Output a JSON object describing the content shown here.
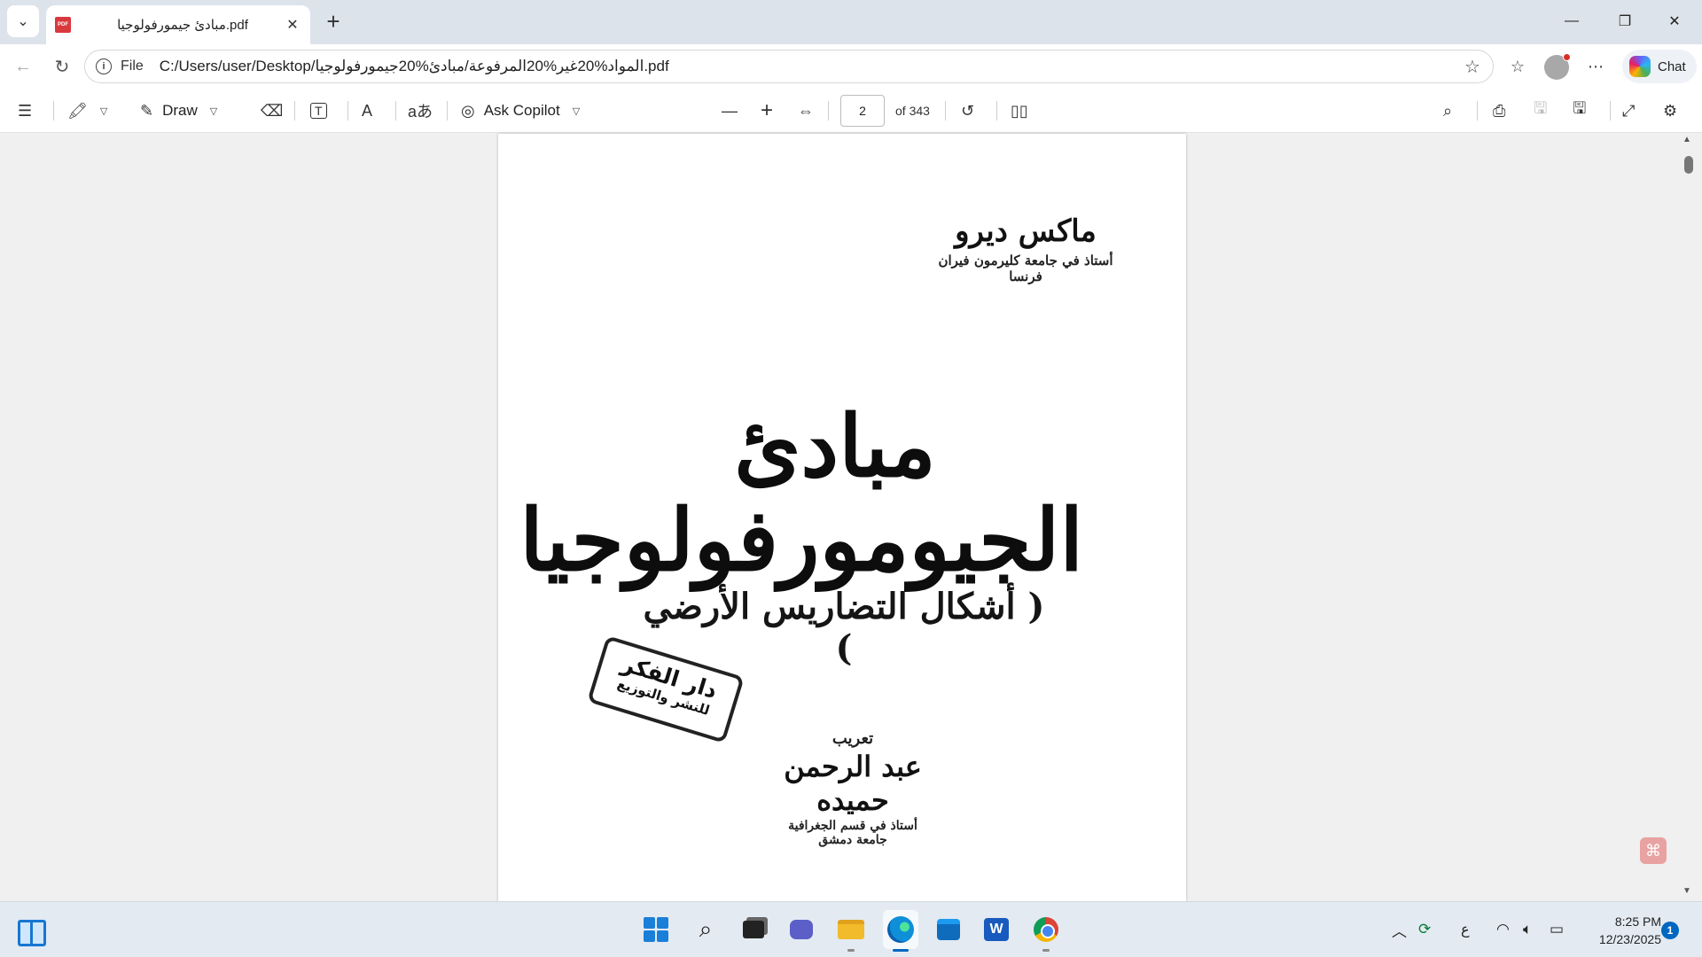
{
  "tab": {
    "title": "مبادئ جيمورفولوجيا.pdf",
    "favicon": "PDF"
  },
  "window": {
    "minimize": "—",
    "restore": "❐",
    "close": "✕"
  },
  "address": {
    "scheme": "File",
    "url": "C:/Users/user/Desktop/المواد%20غير%20المرفوعة/مبادئ%20جيمورفولوجيا.pdf"
  },
  "chat": {
    "label": "Chat"
  },
  "toolbar": {
    "draw_label": "Draw",
    "copilot_label": "Ask Copilot",
    "page_current": "2",
    "page_total": "of 343",
    "read_aloud": "A",
    "translate": "aあ"
  },
  "page": {
    "author_name": "ماكس ديرو",
    "author_title": "أستاذ في جامعة كليرمون فيران",
    "author_country": "فرنسا",
    "book_title": "مبادئ الجيومورفولوجيا",
    "book_subtitle": "( أشكال التضاريس الأرضي )",
    "publisher_line1": "دار الفكر",
    "publisher_line2": "للنشر والتوزيع",
    "translation_label": "تعريب",
    "translator_name": "عبد الرحمن حميده",
    "translator_title": "أستاذ في قسم الجغرافية",
    "translator_university": "جامعة دمشق"
  },
  "taskbar": {
    "word_letter": "W",
    "tray_lang": "ع",
    "time": "8:25 PM",
    "date": "12/23/2025",
    "notifications": "1"
  }
}
